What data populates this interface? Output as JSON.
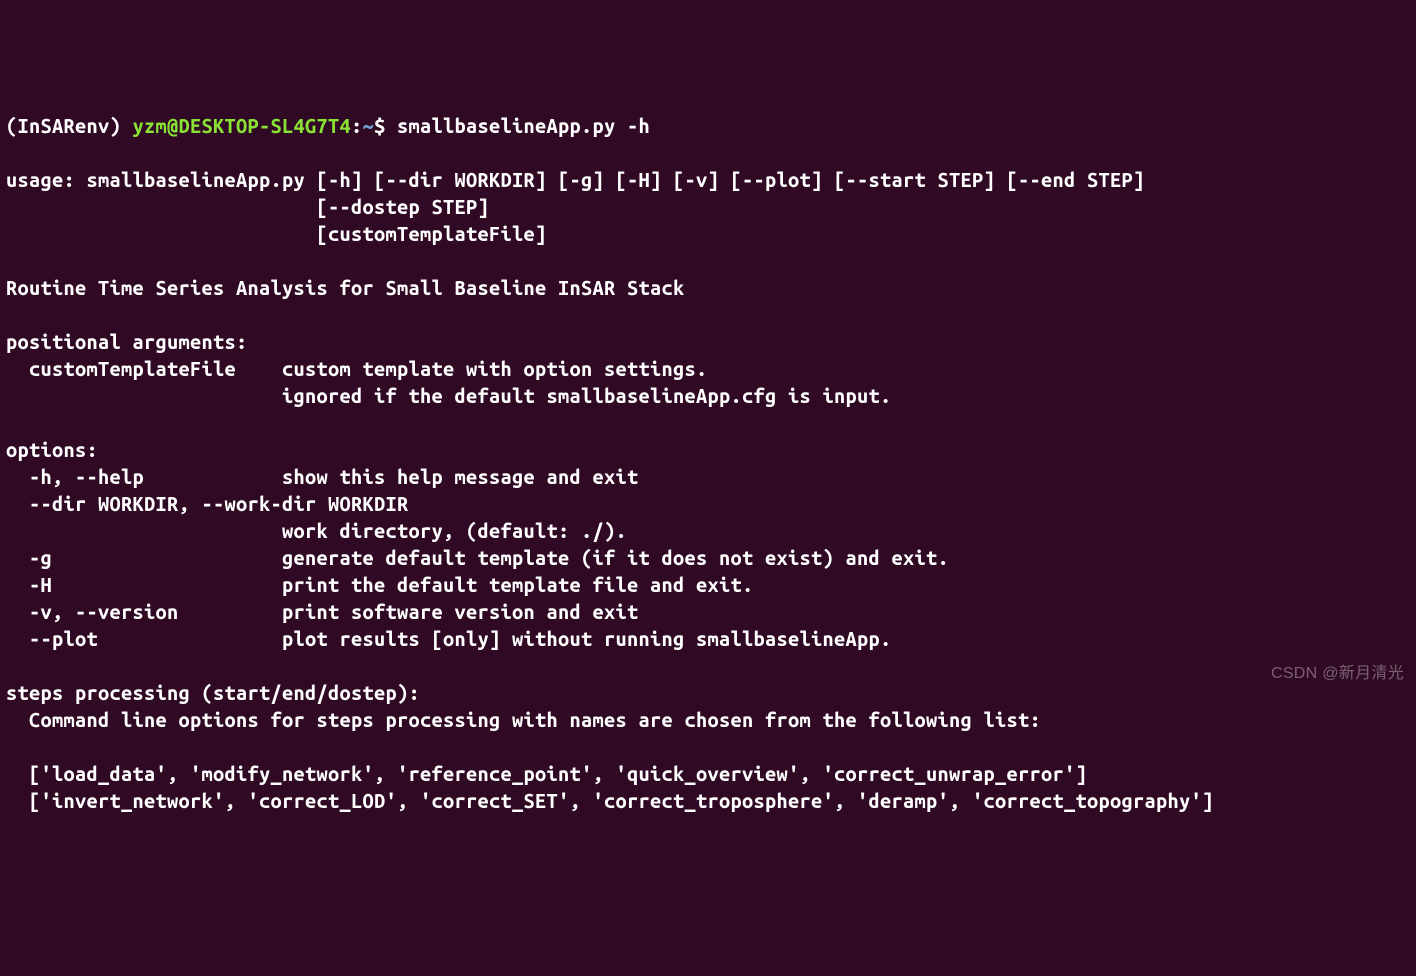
{
  "prompt": {
    "env": "(InSARenv) ",
    "user_host": "yzm@DESKTOP-SL4G7T4",
    "colon": ":",
    "tilde": "~",
    "dollar": "$ ",
    "command": "smallbaselineApp.py -h"
  },
  "usage": {
    "line1": "usage: smallbaselineApp.py [-h] [--dir WORKDIR] [-g] [-H] [-v] [--plot] [--start STEP] [--end STEP]",
    "line2": "                           [--dostep STEP]",
    "line3": "                           [customTemplateFile]"
  },
  "description": "Routine Time Series Analysis for Small Baseline InSAR Stack",
  "positional": {
    "header": "positional arguments:",
    "item1": "  customTemplateFile    custom template with option settings.",
    "item2": "                        ignored if the default smallbaselineApp.cfg is input."
  },
  "options": {
    "header": "options:",
    "help": "  -h, --help            show this help message and exit",
    "dir1": "  --dir WORKDIR, --work-dir WORKDIR",
    "dir2": "                        work directory, (default: ./).",
    "g": "  -g                    generate default template (if it does not exist) and exit.",
    "H": "  -H                    print the default template file and exit.",
    "v": "  -v, --version         print software version and exit",
    "plot": "  --plot                plot results [only] without running smallbaselineApp."
  },
  "steps": {
    "header": "steps processing (start/end/dostep):",
    "desc": "  Command line options for steps processing with names are chosen from the following list:",
    "list1": "  ['load_data', 'modify_network', 'reference_point', 'quick_overview', 'correct_unwrap_error']",
    "list2": "  ['invert_network', 'correct_LOD', 'correct_SET', 'correct_troposphere', 'deramp', 'correct_topography']"
  },
  "watermark": "CSDN @新月清光"
}
